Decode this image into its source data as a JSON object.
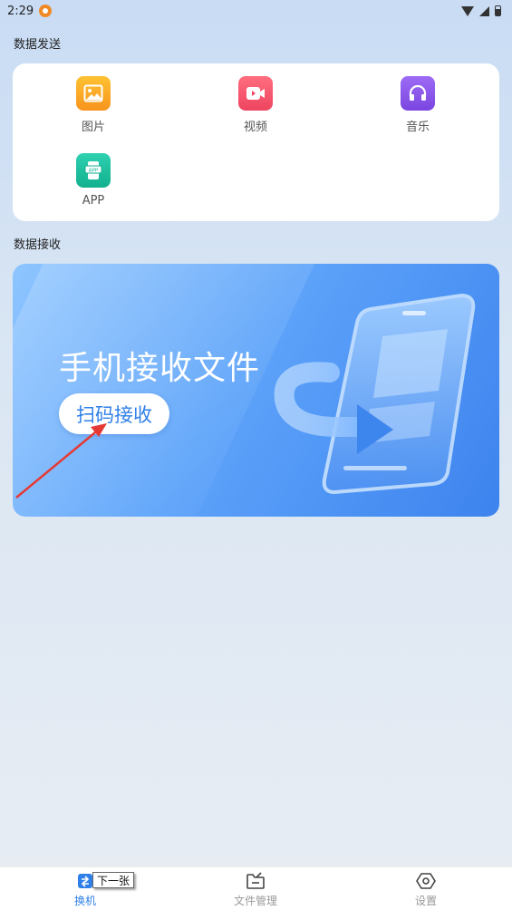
{
  "status_bar": {
    "time": "2:29",
    "notification_icon": "app-notification-icon"
  },
  "send_section": {
    "title": "数据发送",
    "items": [
      {
        "label": "图片",
        "icon": "image-icon",
        "color": "#f9a51a"
      },
      {
        "label": "视频",
        "icon": "video-icon",
        "color": "#f5566c"
      },
      {
        "label": "音乐",
        "icon": "headphones-icon",
        "color": "#8a58e8"
      },
      {
        "label": "APP",
        "icon": "app-icon",
        "color": "#1bbf9f"
      }
    ]
  },
  "receive_section": {
    "title": "数据接收",
    "banner_title": "手机接收文件",
    "scan_button": "扫码接收"
  },
  "tab_bar": {
    "tabs": [
      {
        "label": "换机",
        "icon": "switch-phone-icon",
        "active": true
      },
      {
        "label": "文件管理",
        "icon": "folder-icon",
        "active": false
      },
      {
        "label": "设置",
        "icon": "settings-hex-icon",
        "active": false
      }
    ]
  },
  "tooltip": {
    "text": "下一张"
  },
  "colors": {
    "accent": "#2f7fe8",
    "annotation_arrow": "#e53935"
  }
}
